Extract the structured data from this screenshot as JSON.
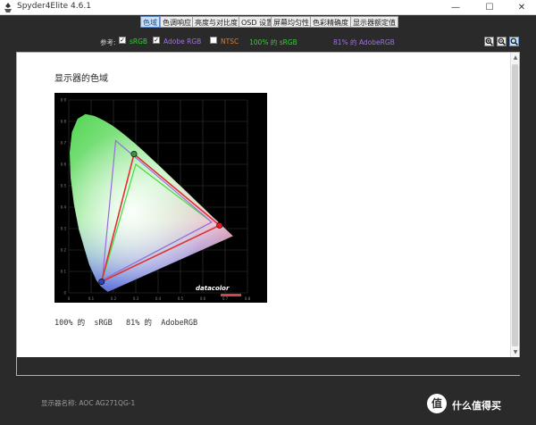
{
  "window": {
    "title": "Spyder4Elite 4.6.1",
    "minimize_glyph": "—",
    "maximize_glyph": "☐",
    "close_glyph": "✕"
  },
  "tabs": [
    {
      "label": "色域",
      "active": true
    },
    {
      "label": "色调响应",
      "active": false
    },
    {
      "label": "亮度与对比度",
      "active": false
    },
    {
      "label": "OSD 设置",
      "active": false
    },
    {
      "label": "屏幕均匀性",
      "active": false
    },
    {
      "label": "色彩精确度",
      "active": false
    },
    {
      "label": "显示器额定值",
      "active": false
    }
  ],
  "reference": {
    "label": "参考:",
    "options": [
      {
        "label": "sRGB",
        "checked": true,
        "color": "#2fd12f"
      },
      {
        "label": "Adobe RGB",
        "checked": true,
        "color": "#a070e0"
      },
      {
        "label": "NTSC",
        "checked": false,
        "color": "#e07a2a"
      }
    ],
    "summary": [
      {
        "text": "100% 的 sRGB",
        "color": "#2fd12f"
      },
      {
        "text": "81% 的 AdobeRGB",
        "color": "#a070e0"
      }
    ]
  },
  "panel": {
    "title": "显示器的色域",
    "result_srgb": "100% 的  sRGB",
    "result_adobe": "81% 的  AdobeRGB",
    "brand": "datacolor"
  },
  "chart_data": {
    "type": "scatter",
    "title": "",
    "xlim": [
      0,
      0.8
    ],
    "ylim": [
      0,
      0.9
    ],
    "x_ticks": [
      "0",
      "0.1",
      "0.2",
      "0.3",
      "0.4",
      "0.5",
      "0.6",
      "0.7",
      "0.8"
    ],
    "y_ticks": [
      "0",
      "0.1",
      "0.2",
      "0.3",
      "0.4",
      "0.5",
      "0.6",
      "0.7",
      "0.8",
      "0.9"
    ],
    "series": [
      {
        "name": "sRGB",
        "color": "#3fdc3f",
        "points": [
          [
            0.64,
            0.33
          ],
          [
            0.3,
            0.6
          ],
          [
            0.15,
            0.06
          ]
        ]
      },
      {
        "name": "Adobe RGB",
        "color": "#9a6ae0",
        "points": [
          [
            0.64,
            0.33
          ],
          [
            0.21,
            0.71
          ],
          [
            0.15,
            0.06
          ]
        ]
      },
      {
        "color": "#e03030",
        "points": [
          [
            0.675,
            0.315
          ],
          [
            0.292,
            0.648
          ],
          [
            0.147,
            0.052
          ]
        ]
      }
    ]
  },
  "footer": {
    "display_name": "显示器名称: AOC AG271QG-1",
    "watermark": "什么值得买",
    "watermark_logo": "值"
  }
}
